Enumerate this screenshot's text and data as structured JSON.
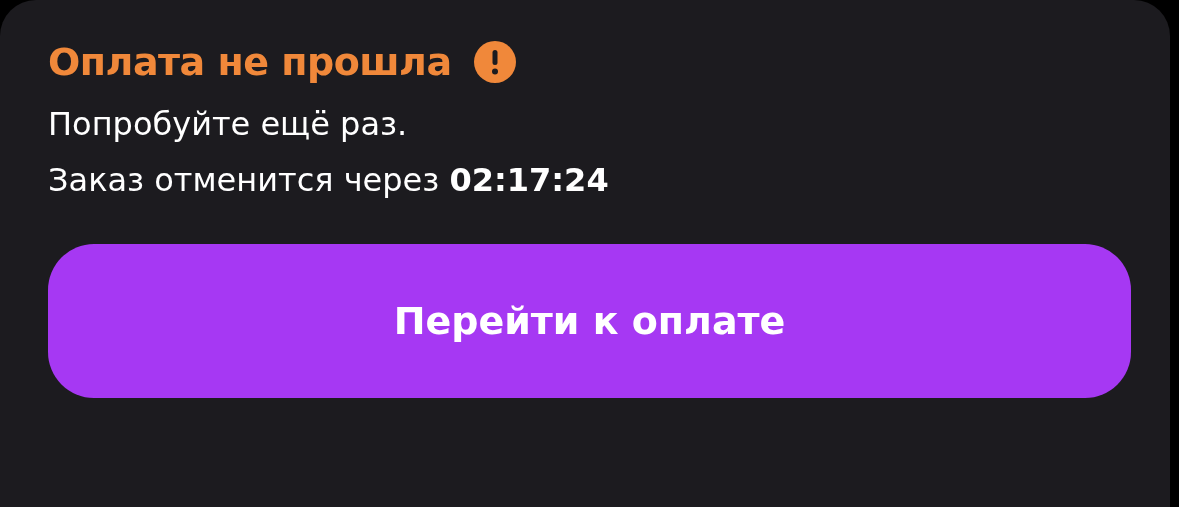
{
  "status": {
    "title": "Оплата не прошла",
    "lines": [
      "Попробуйте ещё раз.",
      "Заказ отменится через **02:17:24**"
    ]
  },
  "pay_button": {
    "label": "Перейти к оплате"
  }
}
